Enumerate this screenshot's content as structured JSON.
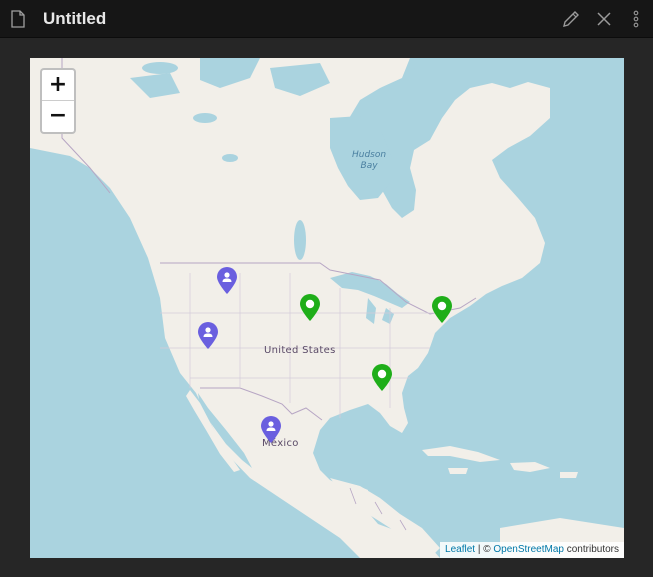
{
  "window": {
    "title": "Untitled",
    "doc_icon": "document-icon",
    "edit_icon": "pencil-icon",
    "close_icon": "close-icon",
    "more_icon": "more-vertical-icon"
  },
  "map": {
    "zoom_in_label": "+",
    "zoom_out_label": "−",
    "places": {
      "hudson_bay_line1": "Hudson",
      "hudson_bay_line2": "Bay",
      "united_states": "United States",
      "mexico": "México"
    },
    "attribution": {
      "leaflet": "Leaflet",
      "separator": " | © ",
      "osm": "OpenStreetMap",
      "contributors": " contributors"
    },
    "colors": {
      "water": "#aad3df",
      "land": "#f2efe9",
      "marker_person": "#6a5fdf",
      "marker_location": "#1fae19"
    }
  },
  "markers": [
    {
      "type": "person",
      "icon": "person-marker-icon"
    },
    {
      "type": "person",
      "icon": "person-marker-icon"
    },
    {
      "type": "person",
      "icon": "person-marker-icon"
    },
    {
      "type": "location",
      "icon": "location-marker-icon"
    },
    {
      "type": "location",
      "icon": "location-marker-icon"
    },
    {
      "type": "location",
      "icon": "location-marker-icon"
    }
  ]
}
